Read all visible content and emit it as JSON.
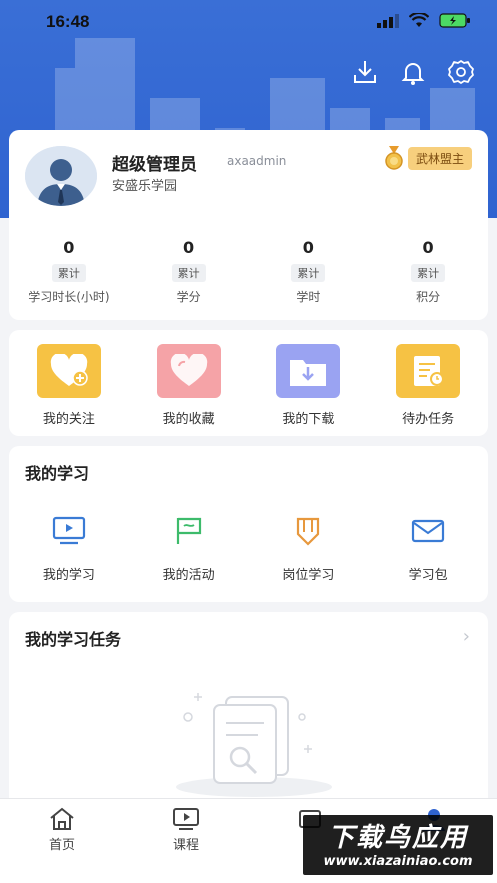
{
  "status": {
    "time": "16:48"
  },
  "profile": {
    "name": "超级管理员",
    "account": "axaadmin",
    "org": "安盛乐学园",
    "badge": "武林盟主"
  },
  "stats": [
    {
      "value": "0",
      "tag": "累计",
      "label": "学习时长(小时)"
    },
    {
      "value": "0",
      "tag": "累计",
      "label": "学分"
    },
    {
      "value": "0",
      "tag": "累计",
      "label": "学时"
    },
    {
      "value": "0",
      "tag": "累计",
      "label": "积分"
    }
  ],
  "quick_actions": [
    {
      "label": "我的关注",
      "icon": "heart-plus-icon",
      "color": "#f6c244"
    },
    {
      "label": "我的收藏",
      "icon": "heart-icon",
      "color": "#f5a3a7"
    },
    {
      "label": "我的下载",
      "icon": "download-folder-icon",
      "color": "#9aa3f2"
    },
    {
      "label": "待办任务",
      "icon": "task-doc-icon",
      "color": "#f6c244"
    }
  ],
  "learning": {
    "title": "我的学习",
    "items": [
      {
        "label": "我的学习",
        "icon": "video-icon"
      },
      {
        "label": "我的活动",
        "icon": "flag-icon"
      },
      {
        "label": "岗位学习",
        "icon": "pencil-icon"
      },
      {
        "label": "学习包",
        "icon": "envelope-icon"
      }
    ]
  },
  "tasks": {
    "title": "我的学习任务"
  },
  "tabs": [
    {
      "label": "首页",
      "icon": "home-icon"
    },
    {
      "label": "课程",
      "icon": "play-icon"
    }
  ],
  "watermark": {
    "top": "下载鸟应用",
    "bottom": "www.xiazainiao.com"
  }
}
